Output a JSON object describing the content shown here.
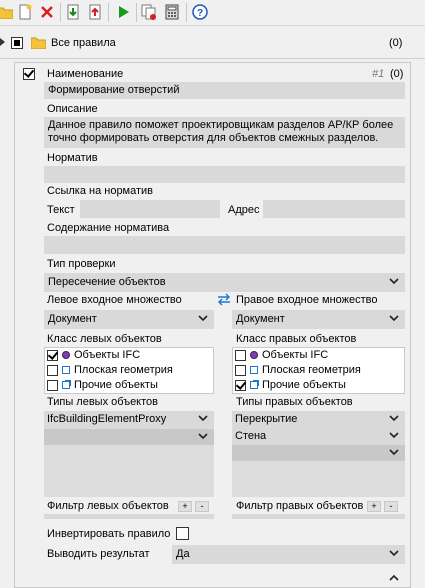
{
  "toolbar": {
    "icons": [
      "open-folder-icon",
      "new-file-icon",
      "delete-icon",
      "move-down-icon",
      "move-up-icon",
      "run-icon",
      "copy-icon",
      "calculator-icon",
      "help-icon"
    ]
  },
  "tree": {
    "label": "Все правила",
    "count": "(0)"
  },
  "rule": {
    "name_label": "Наименование",
    "index": "#1",
    "count": "(0)",
    "name_value": "Формирование отверстий",
    "description_label": "Описание",
    "description_line1": "Данное правило поможет проектировщикам разделов АР/КР более",
    "description_line2": "точно формировать отверстия для объектов смежных разделов.",
    "norm_label": "Норматив",
    "norm_value": "",
    "norm_link_label": "Ссылка на норматив",
    "text_label": "Текст",
    "address_label": "Адрес",
    "norm_content_label": "Содержание норматива",
    "check_type_label": "Тип проверки",
    "check_type_value": "Пересечение объектов",
    "left_set_label": "Левое входное множество",
    "right_set_label": "Правое входное множество",
    "left_set_value": "Документ",
    "right_set_value": "Документ",
    "left_classes_label": "Класс левых объектов",
    "right_classes_label": "Класс правых объектов",
    "left_classes": [
      {
        "label": "Объекты IFC",
        "checked": true
      },
      {
        "label": "Плоская геометрия",
        "checked": false
      },
      {
        "label": "Прочие объекты",
        "checked": false
      }
    ],
    "right_classes": [
      {
        "label": "Объекты IFC",
        "checked": false
      },
      {
        "label": "Плоская геометрия",
        "checked": false
      },
      {
        "label": "Прочие объекты",
        "checked": true
      }
    ],
    "left_types_label": "Типы левых объектов",
    "right_types_label": "Типы правых объектов",
    "left_types": [
      "IfcBuildingElementProxy",
      ""
    ],
    "right_types": [
      "Перекрытие",
      "Стена",
      ""
    ],
    "left_filter_label": "Фильтр левых объектов",
    "right_filter_label": "Фильтр правых объектов",
    "plus": "+",
    "minus": "-",
    "invert_label": "Инвертировать правило",
    "output_label": "Выводить результат",
    "output_value": "Да"
  }
}
